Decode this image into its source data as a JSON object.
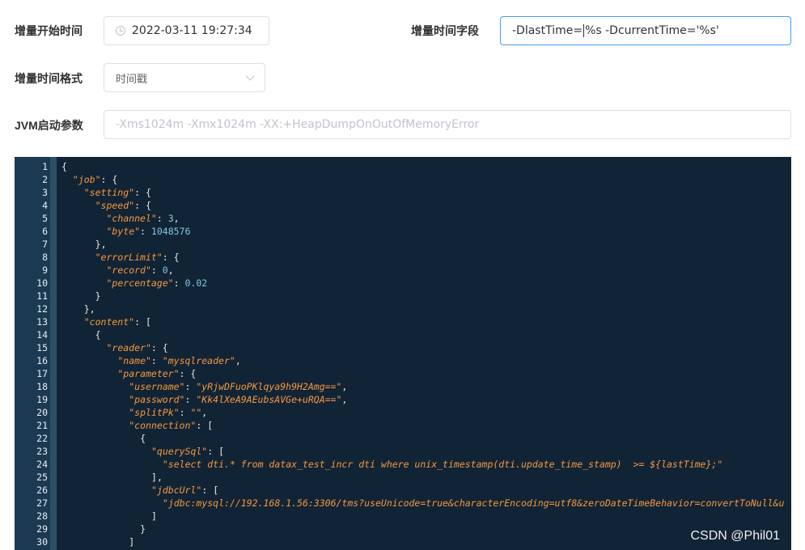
{
  "form": {
    "start_time": {
      "label": "增量开始时间",
      "value": "2022-03-11 19:27:34"
    },
    "time_field": {
      "label": "增量时间字段",
      "value_before": "-DlastTime=",
      "value_after": "%s -DcurrentTime='%s'"
    },
    "time_format": {
      "label": "增量时间格式",
      "selected": "时间戳"
    },
    "jvm": {
      "label": "JVM启动参数",
      "placeholder": "-Xms1024m -Xmx1024m -XX:+HeapDumpOnOutOfMemoryError"
    }
  },
  "editor": {
    "lines": [
      "{",
      "  \"job\": {",
      "    \"setting\": {",
      "      \"speed\": {",
      "        \"channel\": 3,",
      "        \"byte\": 1048576",
      "      },",
      "      \"errorLimit\": {",
      "        \"record\": 0,",
      "        \"percentage\": 0.02",
      "      }",
      "    },",
      "    \"content\": [",
      "      {",
      "        \"reader\": {",
      "          \"name\": \"mysqlreader\",",
      "          \"parameter\": {",
      "            \"username\": \"yRjwDFuoPKlqya9h9H2Amg==\",",
      "            \"password\": \"Kk4lXeA9AEubsAVGe+uRQA==\",",
      "            \"splitPk\": \"\",",
      "            \"connection\": [",
      "              {",
      "                \"querySql\": [",
      "                  \"select dti.* from datax_test_incr dti where unix_timestamp(dti.update_time_stamp)  >= ${lastTime};\"",
      "                ],",
      "                \"jdbcUrl\": [",
      "                  \"jdbc:mysql://192.168.1.56:3306/tms?useUnicode=true&characterEncoding=utf8&zeroDateTimeBehavior=convertToNull&u",
      "                ]",
      "              }",
      "            ]"
    ]
  },
  "watermark": "CSDN @Phil01"
}
